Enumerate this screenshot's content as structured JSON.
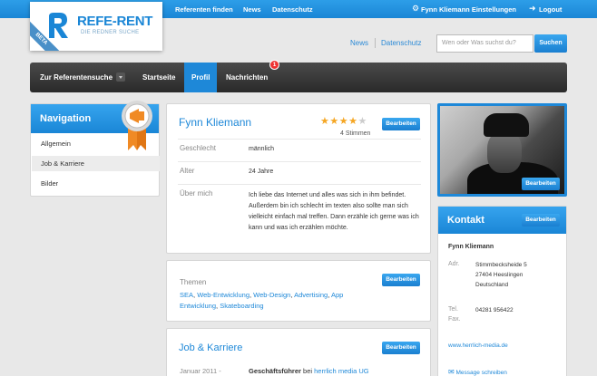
{
  "topbar": {
    "referenten_finden": "Referenten finden",
    "news": "News",
    "datenschutz": "Datenschutz",
    "settings": "Fynn Kliemann Einstellungen",
    "logout": "Logout"
  },
  "logo": {
    "title": "REFE-RENT",
    "subtitle": "DIE REDNER SUCHE",
    "beta": "BETA"
  },
  "subnav": {
    "news": "News",
    "datenschutz": "Datenschutz"
  },
  "search": {
    "placeholder": "Wen oder Was suchst du?",
    "button": "Suchen"
  },
  "mainnav": {
    "zur_suche": "Zur Referentensuche",
    "startseite": "Startseite",
    "profil": "Profil",
    "nachrichten": "Nachrichten",
    "nachrichten_count": "1"
  },
  "navigation": {
    "title": "Navigation",
    "items": [
      "Allgemein",
      "Job & Karriere",
      "Bilder"
    ]
  },
  "profile": {
    "name": "Fynn Kliemann",
    "rating": 4,
    "rating_max": 5,
    "votes": "4 Stimmen",
    "edit": "Bearbeiten",
    "geschlecht_label": "Geschlecht",
    "geschlecht": "männlich",
    "alter_label": "Alter",
    "alter": "24 Jahre",
    "ueber_label": "Über mich",
    "ueber": "Ich liebe das Internet und alles was sich in ihm befindet. Außerdem bin ich schlecht im texten also sollte man sich vielleicht einfach mal treffen. Dann erzähle ich gerne was ich kann und was ich erzählen möchte."
  },
  "themen": {
    "label": "Themen",
    "edit": "Bearbeiten",
    "items": [
      "SEA",
      "Web-Entwicklung",
      "Web-Design",
      "Advertising",
      "App Entwicklung",
      "Skateboarding"
    ]
  },
  "job": {
    "title": "Job & Karriere",
    "edit": "Bearbeiten",
    "date": "Januar 2011 -",
    "position": "Geschäftsführer",
    "bei": "bei",
    "company": "herrlich media UG"
  },
  "photo": {
    "edit": "Bearbeiten"
  },
  "kontakt": {
    "title": "Kontakt",
    "edit": "Bearbeiten",
    "name": "Fynn Kliemann",
    "adr_label": "Adr.",
    "street": "Stimmbecksheide 5",
    "city": "27404 Heeslingen",
    "country": "Deutschland",
    "tel_label": "Tel.",
    "fax_label": "Fax.",
    "tel": "04281 956422",
    "website": "www.herrlich-media.de",
    "message": "Message schreiben"
  },
  "colors": {
    "accent": "#1e88d8",
    "star": "#f5a623",
    "badge": "#e33333",
    "medal": "#f08a24"
  }
}
